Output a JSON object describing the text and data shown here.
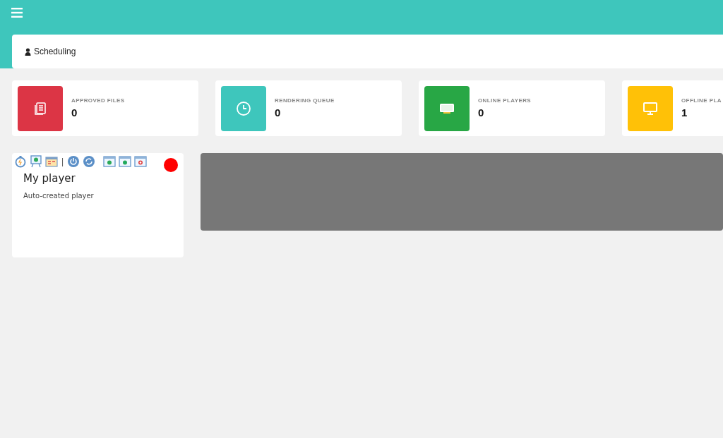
{
  "breadcrumb": {
    "label": "Scheduling"
  },
  "stats": [
    {
      "label": "APPROVED FILES",
      "value": "0",
      "color": "#dc3545",
      "kind": "files"
    },
    {
      "label": "RENDERING QUEUE",
      "value": "0",
      "color": "#3ec6bc",
      "kind": "clock"
    },
    {
      "label": "ONLINE PLAYERS",
      "value": "0",
      "color": "#28a745",
      "kind": "tv"
    },
    {
      "label": "OFFLINE PLA",
      "value": "1",
      "color": "#ffc107",
      "kind": "monitor"
    }
  ],
  "player": {
    "separator": "|",
    "name": "My player",
    "description": "Auto-created player",
    "online": false
  }
}
